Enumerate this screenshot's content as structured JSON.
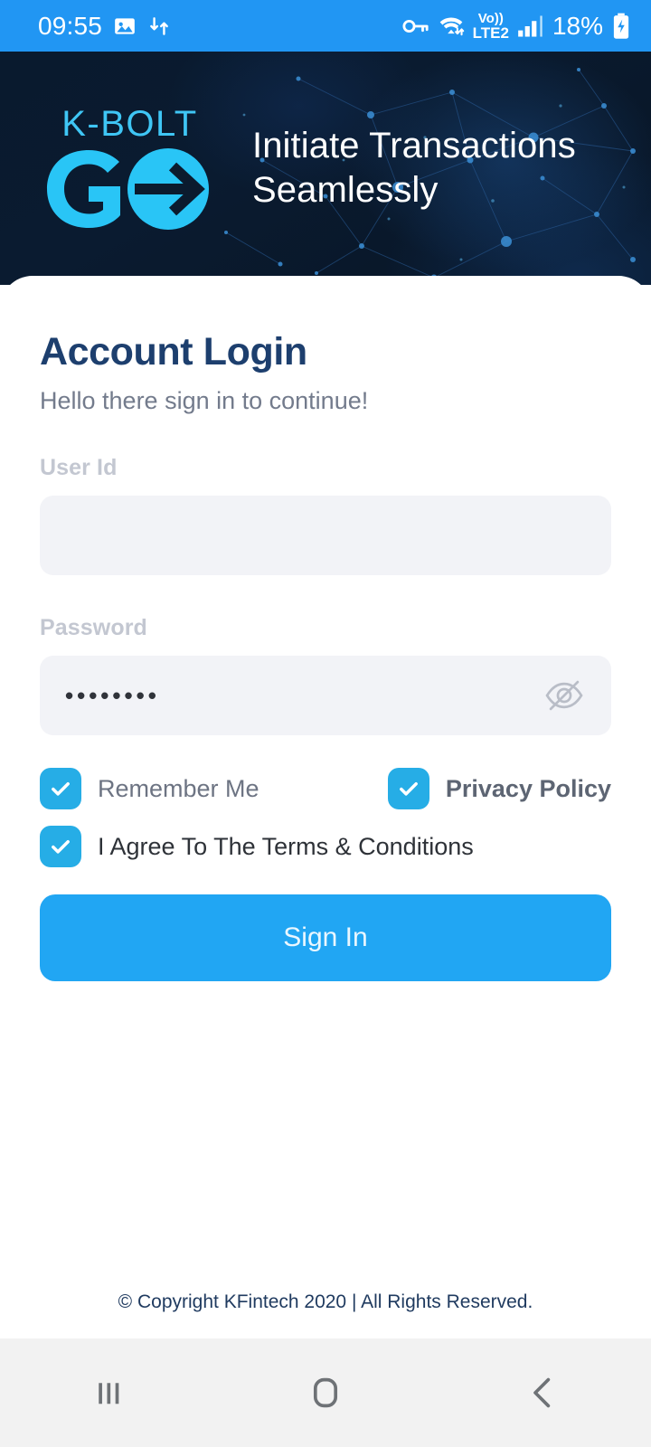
{
  "statusbar": {
    "time": "09:55",
    "battery_percent": "18%",
    "network_label": "LTE2",
    "volte_label": "Vo))",
    "icons": [
      "image-icon",
      "sync-icon",
      "key-icon",
      "wifi-icon",
      "signal-bars-icon",
      "battery-charging-icon"
    ]
  },
  "header": {
    "logo_top": "K-BOLT",
    "logo_bottom": "GO",
    "headline": "Initiate Transactions Seamlessly",
    "bg_color": "#091a2e",
    "logo_color": "#29c5f6",
    "logo_top_color": "#3fc6f5"
  },
  "login": {
    "title": "Account Login",
    "subtitle": "Hello there sign in to continue!",
    "userid": {
      "label": "User Id",
      "value": "",
      "placeholder": ""
    },
    "password": {
      "label": "Password",
      "value": "••••••••",
      "placeholder": "",
      "visibility_icon": "eye-off-icon",
      "masked": true
    },
    "checkboxes": {
      "remember_me": {
        "label": "Remember Me",
        "checked": true
      },
      "privacy_policy": {
        "label": "Privacy Policy",
        "checked": true
      },
      "terms": {
        "label": "I Agree To The Terms & Conditions",
        "checked": true
      }
    },
    "submit_label": "Sign In",
    "accent_color": "#21a6f3",
    "title_color": "#1d3f6e"
  },
  "footer": {
    "copyright": "© Copyright KFintech 2020 | All Rights Reserved."
  },
  "navbar": {
    "recents": "recents-icon",
    "home": "home-icon",
    "back": "back-icon"
  }
}
